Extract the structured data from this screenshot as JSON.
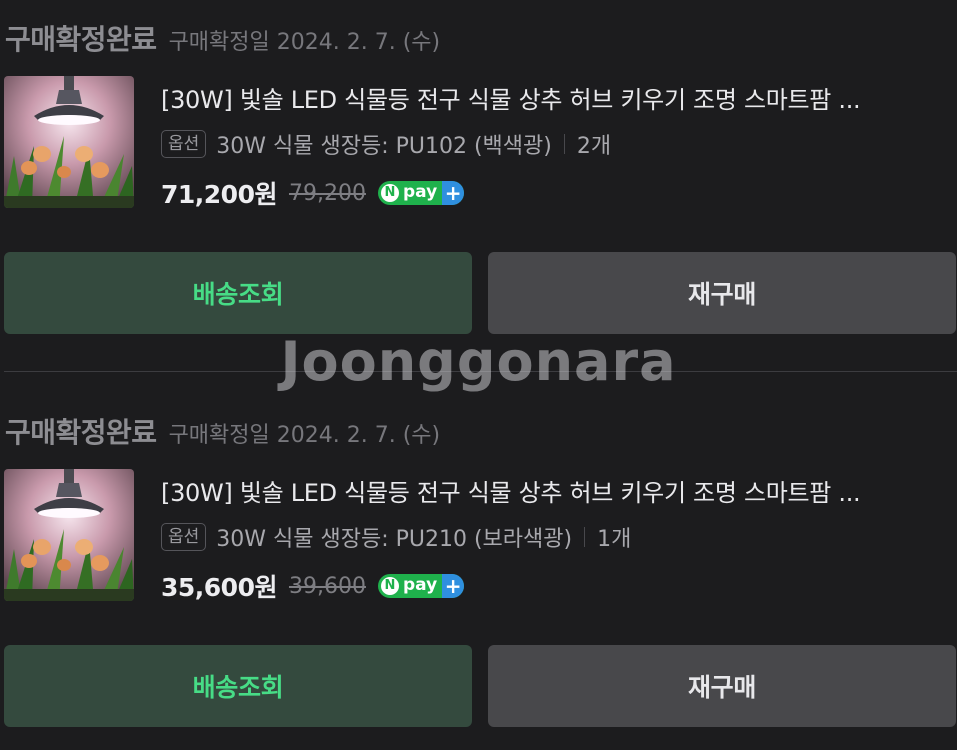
{
  "orders": [
    {
      "status": "구매확정완료",
      "date": "구매확정일 2024. 2. 7. (수)",
      "title": "[30W] 빛솔 LED 식물등 전구 식물 상추 허브 키우기 조명 스마트팜 ...",
      "option_tag": "옵션",
      "option_text": "30W 식물 생장등: PU102 (백색광)",
      "quantity": "2개",
      "price": "71,200원",
      "original_price": "79,200",
      "npay_n": "N",
      "npay_label": "pay",
      "npay_plus": "+",
      "btn_track": "배송조회",
      "btn_rebuy": "재구매"
    },
    {
      "status": "구매확정완료",
      "date": "구매확정일 2024. 2. 7. (수)",
      "title": "[30W] 빛솔 LED 식물등 전구 식물 상추 허브 키우기 조명 스마트팜 ...",
      "option_tag": "옵션",
      "option_text": "30W 식물 생장등: PU210 (보라색광)",
      "quantity": "1개",
      "price": "35,600원",
      "original_price": "39,600",
      "npay_n": "N",
      "npay_label": "pay",
      "npay_plus": "+",
      "btn_track": "배송조회",
      "btn_rebuy": "재구매"
    }
  ],
  "watermark": "Joonggonara",
  "colors": {
    "background": "#1c1c1e",
    "track_button_bg": "#344a3e",
    "track_button_text": "#47dc86",
    "rebuy_button_bg": "#48484b",
    "npay_green": "#1fb14c",
    "npay_blue": "#2f8fdf"
  }
}
